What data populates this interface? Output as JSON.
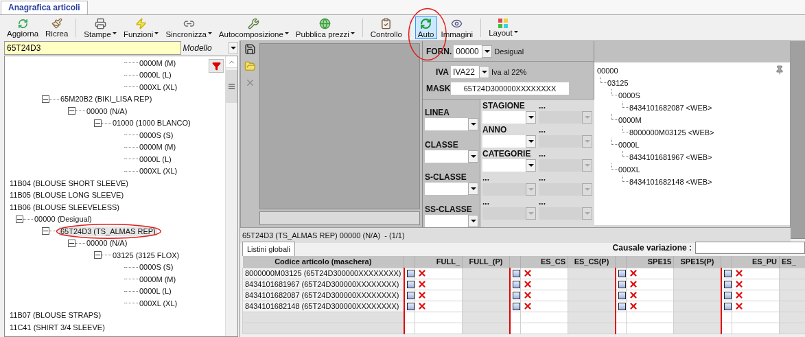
{
  "tabs": [
    {
      "label": "Anagrafica articoli",
      "selected": true
    }
  ],
  "toolbar": [
    [
      {
        "label": "Aggiorna",
        "dropdown": false,
        "selected": false
      },
      {
        "label": "Ricrea",
        "dropdown": false,
        "selected": false
      }
    ],
    [
      {
        "label": "Stampe",
        "dropdown": true,
        "selected": false
      },
      {
        "label": "Funzioni",
        "dropdown": true,
        "selected": false
      },
      {
        "label": "Sincronizza",
        "dropdown": true,
        "selected": false
      },
      {
        "label": "Autocomposizione",
        "dropdown": true,
        "selected": false
      },
      {
        "label": "Pubblica prezzi",
        "dropdown": true,
        "selected": false
      }
    ],
    [
      {
        "label": "Controllo",
        "dropdown": false,
        "selected": false
      }
    ],
    [
      {
        "label": "Auto",
        "dropdown": false,
        "selected": true
      },
      {
        "label": "Immagini",
        "dropdown": false,
        "selected": false
      }
    ],
    [
      {
        "label": "Layout",
        "dropdown": true,
        "selected": false
      }
    ]
  ],
  "search": {
    "value": "65T24D3",
    "scope": "Modello"
  },
  "tree": [
    {
      "children": [
        {
          "children": [
            {
              "children": [
                {
                  "children": [
                    {
                      "children": [
                        {
                          "label": "0000M (M)",
                          "selected": false
                        },
                        {
                          "label": "0000L (L)",
                          "selected": false
                        },
                        {
                          "label": "000XL (XL)",
                          "selected": false
                        }
                      ]
                    }
                  ]
                }
              ]
            },
            {
              "label": "65M20B2 (BIKI_LISA REP)",
              "selected": false,
              "expanded": true,
              "children": [
                {
                  "label": "00000 (N/A)",
                  "selected": false,
                  "expanded": true,
                  "children": [
                    {
                      "label": "01000 (1000 BLANCO)",
                      "selected": false,
                      "expanded": true,
                      "children": [
                        {
                          "label": "0000S (S)",
                          "selected": false
                        },
                        {
                          "label": "0000M (M)",
                          "selected": false
                        },
                        {
                          "label": "0000L (L)",
                          "selected": false
                        },
                        {
                          "label": "000XL (XL)",
                          "selected": false
                        }
                      ]
                    }
                  ]
                }
              ]
            }
          ]
        }
      ]
    },
    {
      "label": "11B04 (BLOUSE SHORT SLEEVE)",
      "selected": false
    },
    {
      "label": "11B05 (BLOUSE LONG SLEEVE)",
      "selected": false
    },
    {
      "label": "11B06 (BLOUSE SLEEVELESS)",
      "selected": false,
      "children": [
        {
          "label": "00000 (Desigual)",
          "selected": false,
          "expanded": true,
          "children": [
            {
              "label": "65T24D3 (TS_ALMAS REP)",
              "selected": true,
              "expanded": true,
              "children": [
                {
                  "label": "00000 (N/A)",
                  "selected": false,
                  "expanded": true,
                  "children": [
                    {
                      "label": "03125 (3125 FLOX)",
                      "selected": false,
                      "expanded": true,
                      "children": [
                        {
                          "label": "0000S (S)",
                          "selected": false
                        },
                        {
                          "label": "0000M (M)",
                          "selected": false
                        },
                        {
                          "label": "0000L (L)",
                          "selected": false
                        },
                        {
                          "label": "000XL (XL)",
                          "selected": false
                        }
                      ]
                    }
                  ]
                }
              ]
            }
          ]
        }
      ]
    },
    {
      "label": "11B07 (BLOUSE STRAPS)",
      "selected": false
    },
    {
      "label": "11C41 (SHIRT 3/4 SLEEVE)",
      "selected": false
    }
  ],
  "detail": {
    "status": "65T24D3 (TS_ALMAS REP) 00000 (N/A)  - (1/1)",
    "supplier": {
      "label": "FORN.",
      "value": "00000",
      "description": "Desigual"
    },
    "vat": {
      "label": "IVA",
      "value": "IVA22",
      "description": "Iva al 22%"
    },
    "mask": {
      "label": "MASK",
      "value": "65T24D300000XXXXXXXX"
    },
    "class_fields": [
      {
        "label": "LINEA"
      },
      {
        "label": "CLASSE"
      },
      {
        "label": "S-CLASSE"
      },
      {
        "label": "SS-CLASSE"
      }
    ],
    "attribute_fields": [
      {
        "label": "STAGIONE",
        "disabled": false
      },
      {
        "label": "...",
        "disabled": true
      },
      {
        "label": "ANNO",
        "disabled": false
      },
      {
        "label": "...",
        "disabled": true
      },
      {
        "label": "CATEGORIE",
        "disabled": false
      },
      {
        "label": "...",
        "disabled": true
      },
      {
        "label": "...",
        "disabled": true
      },
      {
        "label": "...",
        "disabled": true
      },
      {
        "label": "...",
        "disabled": true
      },
      {
        "label": "...",
        "disabled": true
      }
    ]
  },
  "variant_tree": [
    {
      "label": "00000",
      "children": [
        {
          "label": "03125",
          "children": [
            {
              "label": "0000S",
              "children": [
                {
                  "label": "8434101682087 <WEB>"
                }
              ]
            },
            {
              "label": "0000M",
              "children": [
                {
                  "label": "8000000M03125 <WEB>"
                }
              ]
            },
            {
              "label": "0000L",
              "children": [
                {
                  "label": "8434101681967 <WEB>"
                }
              ]
            },
            {
              "label": "000XL",
              "children": [
                {
                  "label": "8434101682148 <WEB>"
                }
              ]
            }
          ]
        }
      ]
    }
  ],
  "price_tabs": [
    {
      "label": "Listini globali",
      "selected": true
    }
  ],
  "change_reason": {
    "label": "Causale variazione :"
  },
  "price_table": {
    "code_column": "Codice articolo (maschera)",
    "groups": [
      {
        "price": "FULL_",
        "promo": "FULL_(P)"
      },
      {
        "price": "ES_CS",
        "promo": "ES_CS(P)"
      },
      {
        "price": "SPE15",
        "promo": "SPE15(P)"
      },
      {
        "price": "ES_PU",
        "promo": "ES_"
      }
    ],
    "rows": [
      {
        "code": "8000000M03125 (65T24D300000XXXXXXXX)",
        "cells": [
          {
            "checked": false
          },
          {
            "checked": false
          },
          {
            "checked": false
          },
          {
            "checked": false
          }
        ]
      },
      {
        "code": "8434101681967 (65T24D300000XXXXXXXX)",
        "cells": [
          {
            "checked": false
          },
          {
            "checked": false
          },
          {
            "checked": false
          },
          {
            "checked": false
          }
        ]
      },
      {
        "code": "8434101682087 (65T24D300000XXXXXXXX)",
        "cells": [
          {
            "checked": false
          },
          {
            "checked": false
          },
          {
            "checked": false
          },
          {
            "checked": false
          }
        ]
      },
      {
        "code": "8434101682148 (65T24D300000XXXXXXXX)",
        "cells": [
          {
            "checked": false
          },
          {
            "checked": false
          },
          {
            "checked": false
          },
          {
            "checked": false
          }
        ]
      }
    ]
  }
}
